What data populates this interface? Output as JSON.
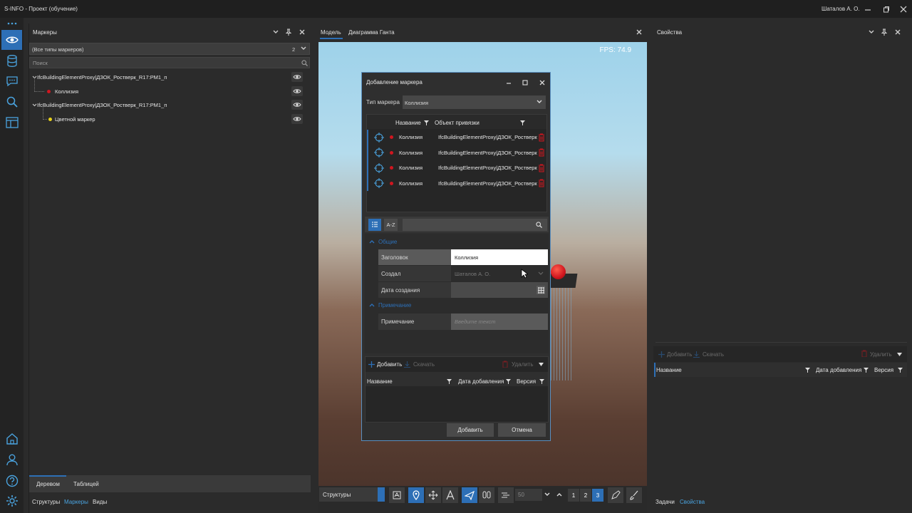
{
  "app": {
    "title": "S-INFO - Проект (обучение)",
    "user": "Шаталов А. О."
  },
  "markers_panel": {
    "title": "Маркеры",
    "filter_value": "(Все типы маркеров)",
    "filter_count": "2",
    "search_placeholder": "Поиск",
    "tree": [
      {
        "label": "IfcBuildingElementProxy|ДЗОК_Ростверк_R17:РМ1_п",
        "child": {
          "label": "Коллизия",
          "dot_color": "#d0161f"
        }
      },
      {
        "label": "IfcBuildingElementProxy|ДЗОК_Ростверк_R17:РМ1_п",
        "child": {
          "label": "Цветной маркер",
          "dot_color": "#e8d21a"
        }
      }
    ],
    "bottom_tabs": [
      "Деревом",
      "Таблицей"
    ],
    "footer_tabs": [
      "Структуры",
      "Маркеры",
      "Виды"
    ]
  },
  "model_panel": {
    "tabs": [
      "Модель",
      "Диаграмма Ганта"
    ],
    "fps": "FPS: 74.9"
  },
  "dialog": {
    "title": "Добавление маркера",
    "marker_type_label": "Тип маркера",
    "marker_type_value": "Коллизия",
    "grid_headers": {
      "name": "Название",
      "object": "Объект привязки"
    },
    "rows": [
      {
        "name": "Коллизия",
        "object": "IfcBuildingElementProxy|ДЗОК_Ростверк"
      },
      {
        "name": "Коллизия",
        "object": "IfcBuildingElementProxy|ДЗОК_Ростверк"
      },
      {
        "name": "Коллизия",
        "object": "IfcBuildingElementProxy|ДЗОК_Ростверк"
      },
      {
        "name": "Коллизия",
        "object": "IfcBuildingElementProxy|ДЗОК_Ростверк"
      }
    ],
    "az_label": "A-Z",
    "groups": {
      "general": "Общие",
      "note": "Примечание"
    },
    "props": {
      "title_label": "Заголовок",
      "title_value": "Коллизия",
      "author_label": "Создал",
      "author_value": "Шаталов А. О.",
      "date_label": "Дата создания",
      "date_value": "",
      "note_label": "Примечание",
      "note_placeholder": "Введите текст"
    },
    "attach_toolbar": {
      "add": "Добавить",
      "download": "Скачать",
      "delete": "Удалить"
    },
    "attach_headers": {
      "name": "Название",
      "date": "Дата добавления",
      "version": "Версия"
    },
    "buttons": {
      "ok": "Добавить",
      "cancel": "Отмена"
    }
  },
  "bottom_toolbar": {
    "structure_label": "Структуры",
    "zoom_value": "50",
    "pages": [
      "1",
      "2",
      "3"
    ]
  },
  "properties_panel": {
    "title": "Свойства",
    "toolbar": {
      "add": "Добавить",
      "download": "Скачать",
      "delete": "Удалить"
    },
    "headers": {
      "name": "Название",
      "date": "Дата добавления",
      "version": "Версия"
    },
    "footer_tabs": [
      "Задачи",
      "Свойства"
    ]
  },
  "colors": {
    "accent": "#2d6fb6",
    "marker_red": "#d0161f",
    "marker_yellow": "#e8d21a"
  }
}
